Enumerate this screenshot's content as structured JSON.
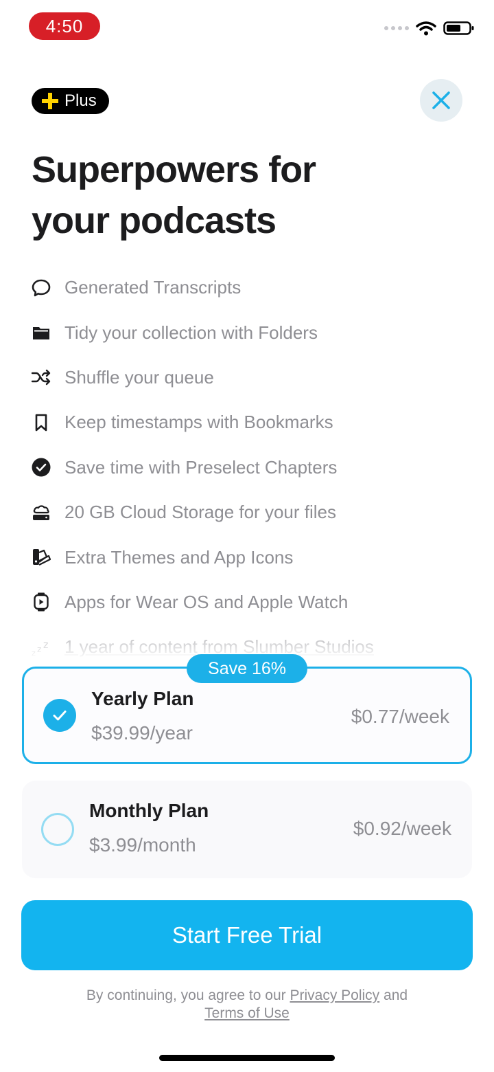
{
  "status_bar": {
    "time": "4:50",
    "time_pill_color": "#d71f27"
  },
  "header": {
    "badge_label": "Plus",
    "badge_icon": "plus-sparkle-icon",
    "close_icon": "close-icon"
  },
  "title": {
    "line1": "Superpowers for",
    "line2": "your podcasts"
  },
  "features": [
    {
      "icon": "speech-bubble-icon",
      "label": "Generated Transcripts"
    },
    {
      "icon": "folder-icon",
      "label": "Tidy your collection with Folders"
    },
    {
      "icon": "shuffle-icon",
      "label": "Shuffle your queue"
    },
    {
      "icon": "bookmark-icon",
      "label": "Keep timestamps with Bookmarks"
    },
    {
      "icon": "check-circle-icon",
      "label": "Save time with Preselect Chapters"
    },
    {
      "icon": "cloud-storage-icon",
      "label": "20 GB Cloud Storage for your files"
    },
    {
      "icon": "palette-icon",
      "label": "Extra Themes and App Icons"
    },
    {
      "icon": "watch-icon",
      "label": "Apps for Wear OS and Apple Watch"
    },
    {
      "icon": "sleep-zzz-icon",
      "label": "1 year of content from Slumber Studios"
    }
  ],
  "plans": {
    "save_badge": "Save 16%",
    "yearly": {
      "name": "Yearly Plan",
      "price": "$39.99/year",
      "weekly": "$0.77/week",
      "selected": true
    },
    "monthly": {
      "name": "Monthly Plan",
      "price": "$3.99/month",
      "weekly": "$0.92/week",
      "selected": false
    }
  },
  "cta": {
    "label": "Start Free Trial"
  },
  "legal": {
    "prefix": "By continuing, you agree to our",
    "privacy": "Privacy Policy",
    "and": "and",
    "terms": "Terms of Use"
  },
  "colors": {
    "accent": "#1cb0e8",
    "cta": "#13b4ef",
    "badge_plus": "#ffd200"
  }
}
